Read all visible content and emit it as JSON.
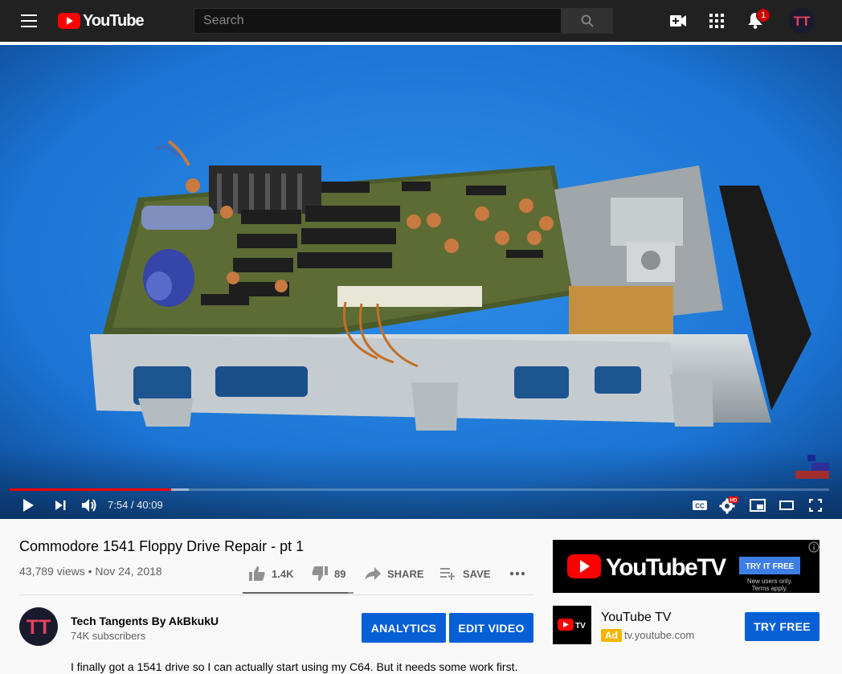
{
  "masthead": {
    "logo_text": "YouTube",
    "search_placeholder": "Search",
    "notification_count": "1",
    "avatar_initials": "TT"
  },
  "player": {
    "time_display": "7:54 / 40:09",
    "progress_played": 0.197,
    "progress_loaded": 0.219,
    "hd_badge": "HD",
    "cc_label": "CC"
  },
  "video": {
    "title": "Commodore 1541 Floppy Drive Repair - pt 1",
    "views_date": "43,789 views • Nov 24, 2018",
    "likes": "1.4K",
    "dislikes": "89",
    "share_label": "SHARE",
    "save_label": "SAVE",
    "like_ratio": 0.95
  },
  "channel": {
    "name": "Tech Tangents By AkBkukU",
    "subscribers": "74K subscribers",
    "avatar_initials": "TT",
    "analytics_label": "ANALYTICS",
    "edit_video_label": "EDIT VIDEO"
  },
  "description": "I finally got a 1541 drive so I can actually start using my C64. But it needs some work first.",
  "ad": {
    "banner_brand": "YouTubeTV",
    "banner_cta": "TRY IT FREE",
    "banner_note_line1": "New users only.",
    "banner_note_line2": "Terms apply.",
    "logo_text": "TV",
    "title": "YouTube TV",
    "badge": "Ad",
    "url": "tv.youtube.com",
    "cta": "TRY FREE"
  },
  "colors": {
    "brand_red": "#ff0000",
    "button_blue": "#065fd4",
    "masthead_bg": "#212121",
    "video_bg": "#1565c0"
  }
}
